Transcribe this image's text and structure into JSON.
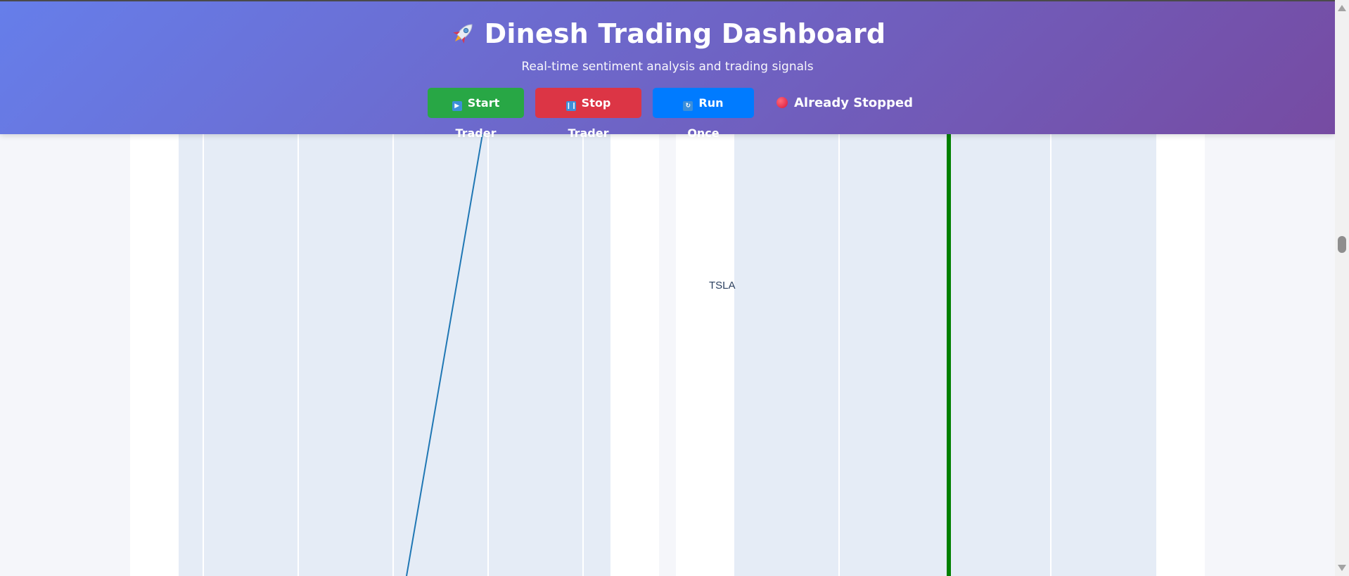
{
  "header": {
    "title": "Dinesh Trading Dashboard",
    "subtitle": "Real-time sentiment analysis and trading signals",
    "gradient_start": "#667eea",
    "gradient_end": "#764ba2",
    "logo_icon": "rocket-icon"
  },
  "controls": {
    "start_label": "Start Trader",
    "start_icon": "play-icon",
    "start_color": "#28a745",
    "stop_label": "Stop Trader",
    "stop_icon": "pause-icon",
    "stop_color": "#dc3545",
    "run_once_label": "Run Once",
    "run_once_icon": "refresh-icon",
    "run_once_color": "#007bff",
    "status_label": "Already Stopped",
    "status_icon": "red-circle-icon"
  },
  "chart_data": [
    {
      "type": "line",
      "series": [
        {
          "values": []
        }
      ],
      "line_color": "#1f77b4",
      "plot_background": "#e5ecf6",
      "grid": true
    },
    {
      "type": "bar",
      "categories": [
        "TSLA"
      ],
      "bar_color": "#008000",
      "plot_background": "#e5ecf6",
      "grid": true
    }
  ]
}
